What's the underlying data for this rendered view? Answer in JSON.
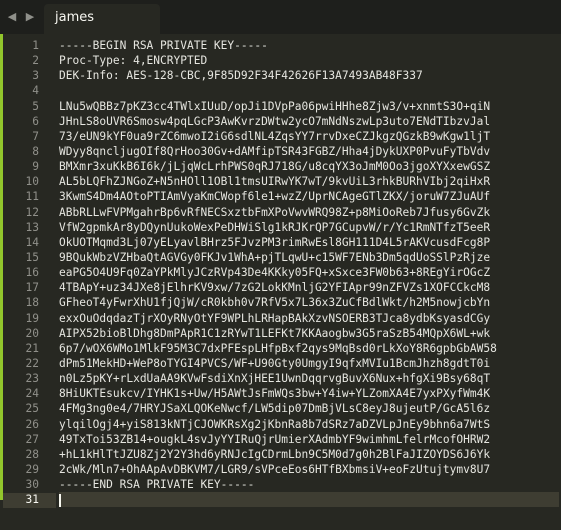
{
  "tab": {
    "title": "james",
    "nav_left": "◀",
    "nav_right": "▶"
  },
  "editor": {
    "current_line": 31,
    "lines": [
      "-----BEGIN RSA PRIVATE KEY-----",
      "Proc-Type: 4,ENCRYPTED",
      "DEK-Info: AES-128-CBC,9F85D92F34F42626F13A7493AB48F337",
      "",
      "LNu5wQBBz7pKZ3cc4TWlxIUuD/opJi1DVpPa06pwiHHhe8Zjw3/v+xnmtS3O+qiN",
      "JHnLS8oUVR6Smosw4pqLGcP3AwKvrzDWtw2ycO7mNdNszwLp3uto7ENdTIbzvJal",
      "73/eUN9kYF0ua9rZC6mwoI2iG6sdlNL4ZqsYY7rrvDxeCZJkgzQGzkB9wKgw1ljT",
      "WDyy8qncljugOIf8QrHoo30Gv+dAMfipTSR43FGBZ/Hha4jDykUXP0PvuFyTbVdv",
      "BMXmr3xuKkB6I6k/jLjqWcLrhPWS0qRJ718G/u8cqYX3oJmM0Oo3jgoXYXxewGSZ",
      "AL5bLQFhZJNGoZ+N5nHOll1OBl1tmsUIRwYK7wT/9kvUiL3rhkBURhVIbj2qiHxR",
      "3KwmS4Dm4AOtoPTIAmVyaKmCWopf6le1+wzZ/UprNCAgeGTlZKX/joruW7ZJuAUf",
      "ABbRLLwFVPMgahrBp6vRfNECSxztbFmXPoVwvWRQ98Z+p8MiOoReb7Jfusy6GvZk",
      "VfW2gpmkAr8yDQynUukoWexPeDHWiSlg1kRJKrQP7GCupvW/r/Yc1RmNTfzT5eeR",
      "OkUOTMqmd3Lj07yELyavlBHrz5FJvzPM3rimRwEsl8GH111D4L5rAKVcusdFcg8P",
      "9BQukWbzVZHbaQtAGVGy0FKJv1WhA+pjTLqwU+c15WF7ENb3Dm5qdUoSSlPzRjze",
      "eaPG5O4U9Fq0ZaYPkMlyJCzRVp43De4KKky05FQ+xSxce3FW0b63+8REgYirOGcZ",
      "4TBApY+uz34JXe8jElhrKV9xw/7zG2LokKMnljG2YFIApr99nZFVZs1XOFCCkcM8",
      "GFheoT4yFwrXhU1fjQjW/cR0kbh0v7RfV5x7L36x3ZuCfBdlWkt/h2M5nowjcbYn",
      "exxOuOdqdazTjrXOyRNyOtYF9WPLhLRHapBAkXzvNSOERB3TJca8ydbKsyasdCGy",
      "AIPX52bioBlDhg8DmPApR1C1zRYwT1LEFKt7KKAaogbw3G5raSzB54MQpX6WL+wk",
      "6p7/wOX6WMo1MlkF95M3C7dxPFEspLHfpBxf2qys9MqBsd0rLkXoY8R6gpbGbAW58",
      "dPm51MekHD+WeP8oTYGI4PVCS/WF+U90Gty0UmgyI9qfxMVIu1BcmJhzh8gdtT0i",
      "n0Lz5pKY+rLxdUaAA9KVwFsdiXnXjHEE1UwnDqqrvgBuvX6Nux+hfgXi9Bsy68qT",
      "8HiUKTEsukcv/IYHK1s+Uw/H5AWtJsFmWQs3bw+Y4iw+YLZomXA4E7yxPXyfWm4K",
      "4FMg3ng0e4/7HRYJSaXLQOKeNwcf/LW5dip07DmBjVLsC8eyJ8ujeutP/GcA5l6z",
      "ylqilOgj4+yiS813kNTjCJOWKRsXg2jKbnRa8b7dSRz7aDZVLpJnEy9bhn6a7WtS",
      "49TxToi53ZB14+ougkL4svJyYYIRuQjrUmierXAdmbYF9wimhmLfelrMcofOHRW2",
      "+hL1kHlTtJZU8Zj2Y2Y3hd6yRNJcIgCDrmLbn9C5M0d7g0h2BlFaJIZOYDS6J6Yk",
      "2cWk/Mln7+OhAApAvDBKVM7/LGR9/sVPceEos6HTfBXbmsiV+eoFzUtujtymv8U7",
      "-----END RSA PRIVATE KEY-----",
      ""
    ]
  }
}
